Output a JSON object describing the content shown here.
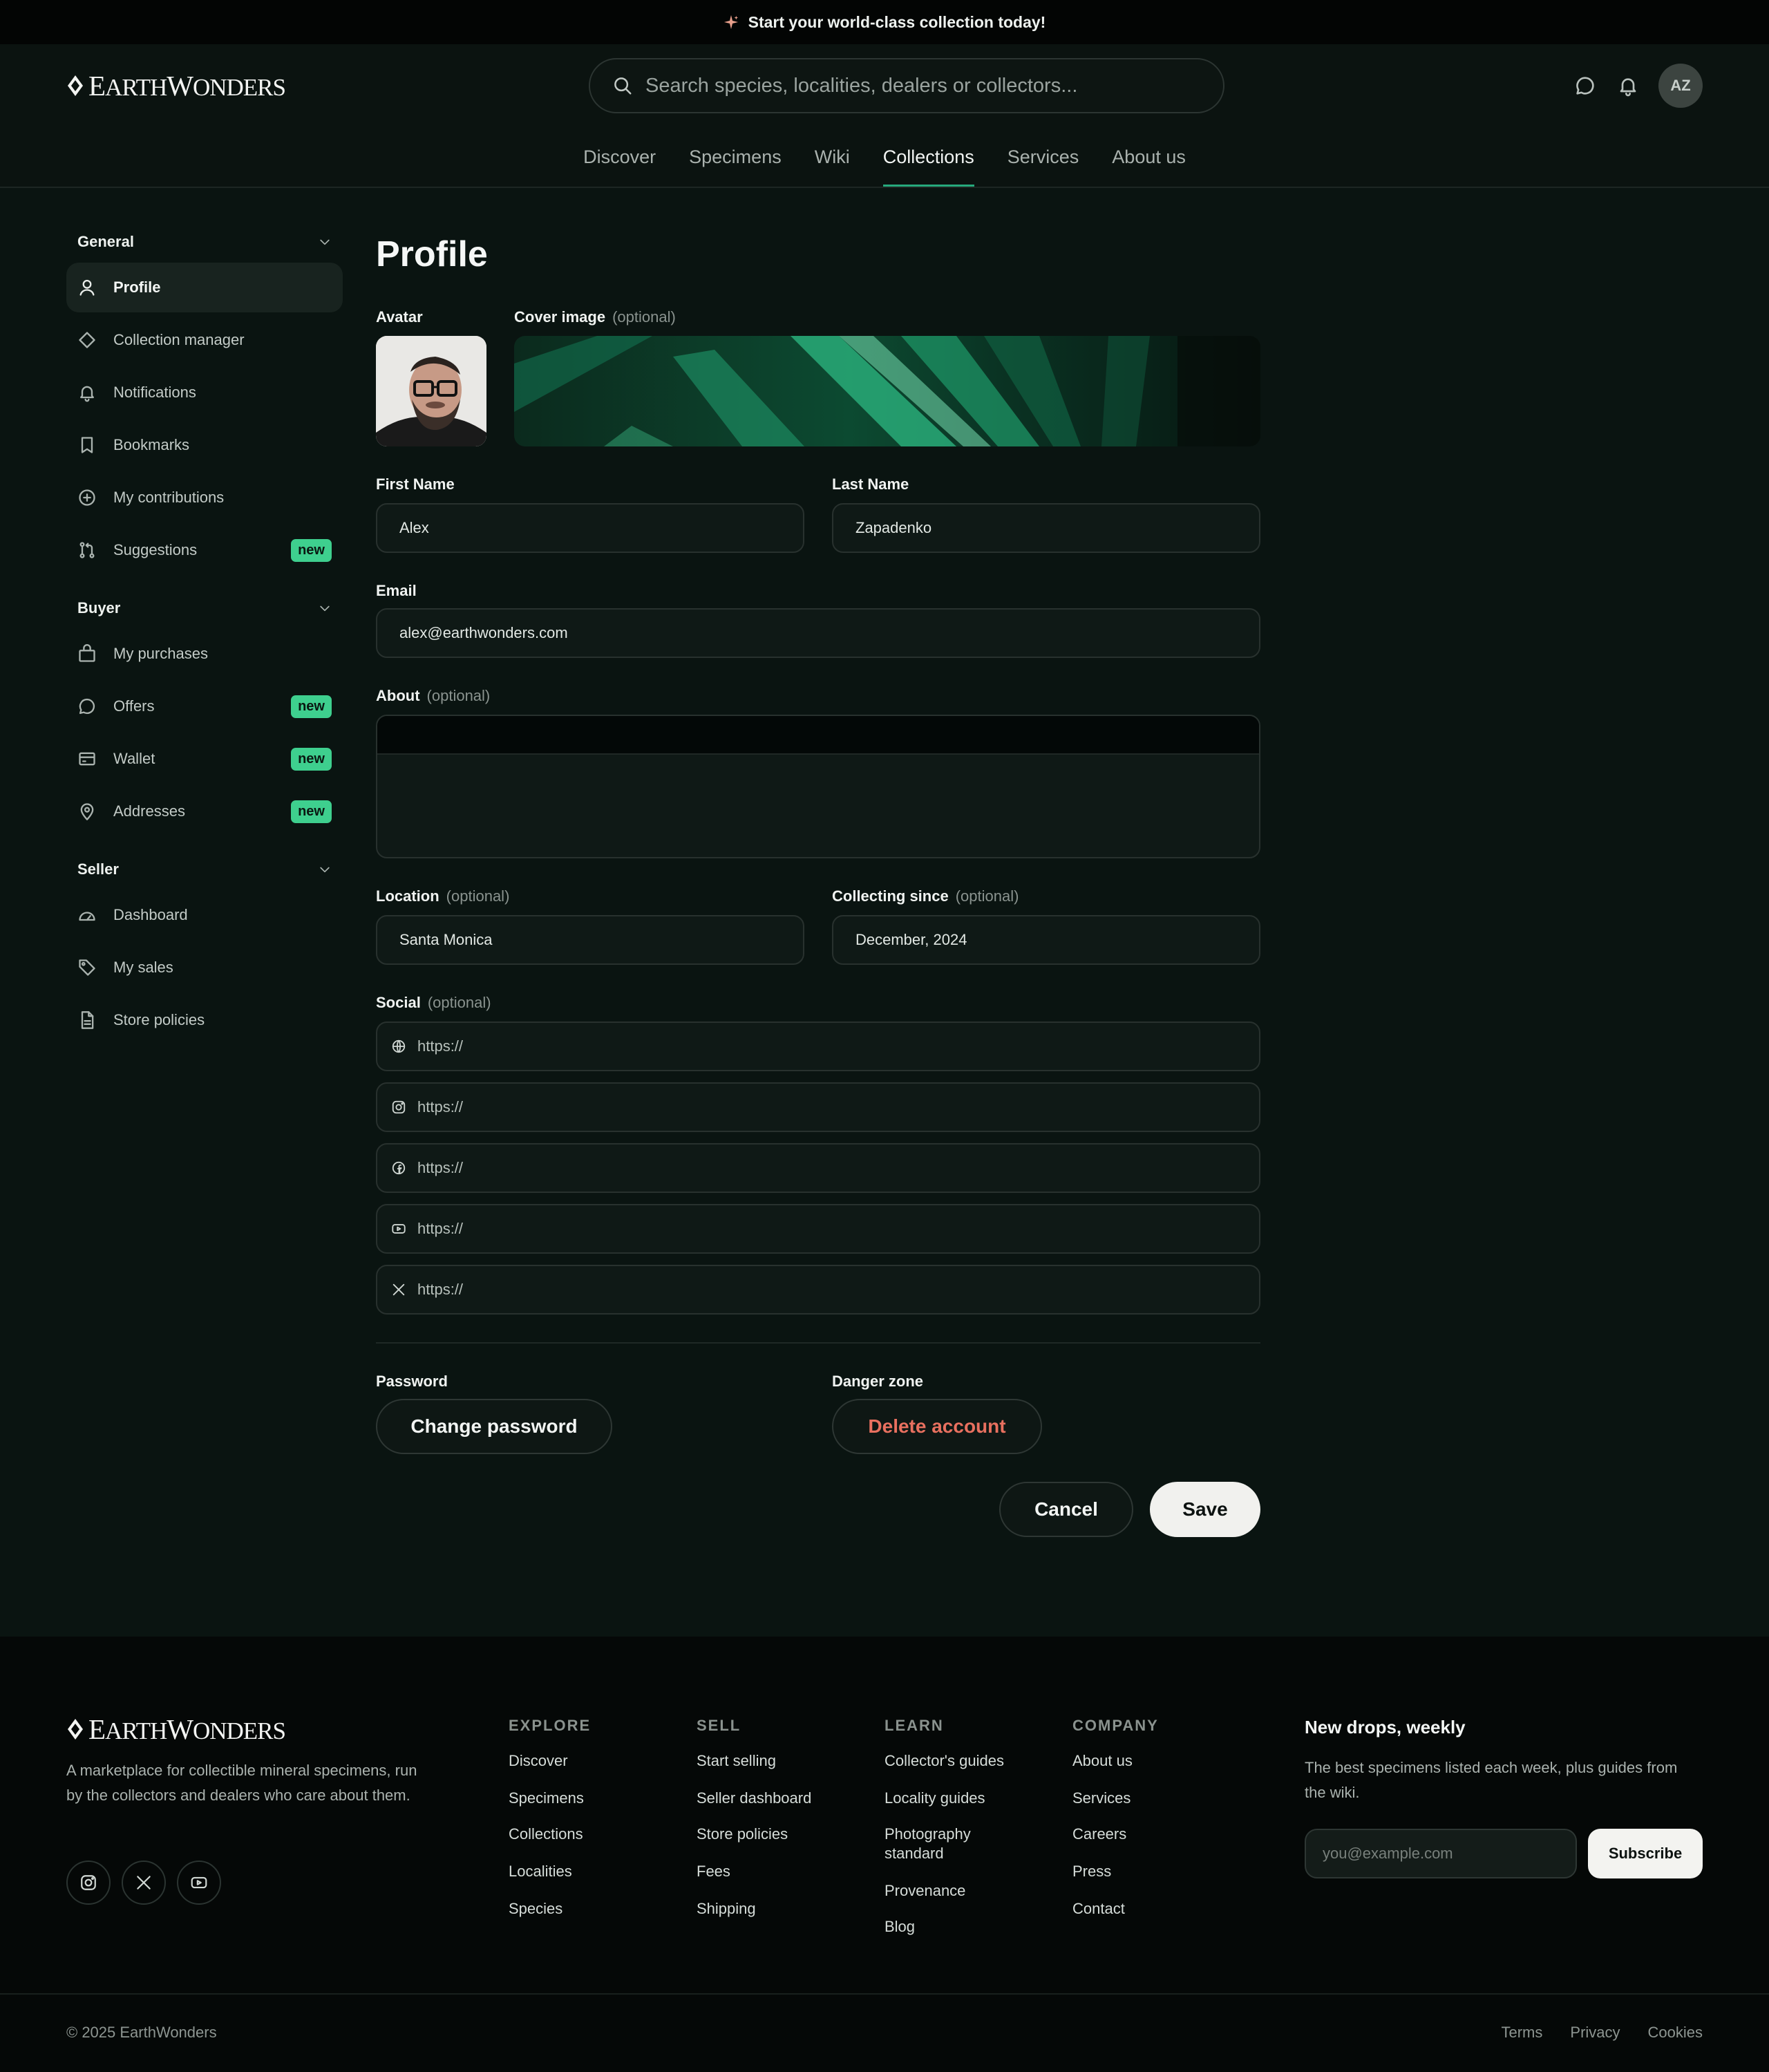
{
  "topbar": {
    "icon": "sparkle-icon",
    "text": "Start your world-class collection today!",
    "accent": "#e8a08c"
  },
  "header": {
    "brand": {
      "first": "E",
      "rest1": "ARTH",
      "second": "W",
      "rest2": "ONDERS"
    },
    "search_placeholder": "Search species, localities, dealers or collectors...",
    "avatar_initials": "AZ",
    "nav": [
      {
        "label": "Discover"
      },
      {
        "label": "Specimens"
      },
      {
        "label": "Wiki"
      },
      {
        "label": "Collections",
        "active": true
      },
      {
        "label": "Services"
      },
      {
        "label": "About us"
      }
    ]
  },
  "sidebar": {
    "sections": [
      {
        "title": "General",
        "items": [
          {
            "label": "Profile",
            "icon": "user-icon",
            "active": true
          },
          {
            "label": "Collection manager",
            "icon": "diamond-icon"
          },
          {
            "label": "Notifications",
            "icon": "bell-icon"
          },
          {
            "label": "Bookmarks",
            "icon": "bookmark-icon"
          },
          {
            "label": "My contributions",
            "icon": "plus-circle-icon"
          },
          {
            "label": "Suggestions",
            "icon": "git-pull-icon",
            "badge": "new"
          }
        ]
      },
      {
        "title": "Buyer",
        "items": [
          {
            "label": "My purchases",
            "icon": "bag-icon"
          },
          {
            "label": "Offers",
            "icon": "chat-icon",
            "badge": "new"
          },
          {
            "label": "Wallet",
            "icon": "card-icon",
            "badge": "new"
          },
          {
            "label": "Addresses",
            "icon": "pin-icon",
            "badge": "new"
          }
        ]
      },
      {
        "title": "Seller",
        "items": [
          {
            "label": "Dashboard",
            "icon": "gauge-icon"
          },
          {
            "label": "My sales",
            "icon": "tag-icon"
          },
          {
            "label": "Store policies",
            "icon": "document-icon"
          }
        ]
      }
    ]
  },
  "profile": {
    "title": "Profile",
    "avatar_label": "Avatar",
    "cover_label": "Cover image",
    "optional": "(optional)",
    "first_name_label": "First Name",
    "first_name": "Alex",
    "last_name_label": "Last Name",
    "last_name": "Zapadenko",
    "email_label": "Email",
    "email": "alex@earthwonders.com",
    "about_label": "About",
    "about": "",
    "location_label": "Location",
    "location": "Santa Monica",
    "since_label": "Collecting since",
    "since": "December, 2024",
    "social_label": "Social",
    "social": [
      {
        "icon": "globe-icon",
        "placeholder": "https://"
      },
      {
        "icon": "instagram-icon",
        "placeholder": "https://"
      },
      {
        "icon": "facebook-icon",
        "placeholder": "https://"
      },
      {
        "icon": "youtube-icon",
        "placeholder": "https://"
      },
      {
        "icon": "x-icon",
        "placeholder": "https://"
      }
    ],
    "password_label": "Password",
    "change_password": "Change password",
    "danger_label": "Danger zone",
    "delete_account": "Delete account",
    "delete_color": "#e8705f",
    "cancel": "Cancel",
    "save": "Save"
  },
  "footer": {
    "tagline": "A marketplace for collectible mineral specimens, run by the collectors and dealers who care about them.",
    "columns": [
      {
        "title": "EXPLORE",
        "links": [
          "Discover",
          "Specimens",
          "Collections",
          "Localities",
          "Species"
        ]
      },
      {
        "title": "SELL",
        "links": [
          "Start selling",
          "Seller dashboard",
          "Store policies",
          "Fees",
          "Shipping"
        ]
      },
      {
        "title": "LEARN",
        "links": [
          "Collector's guides",
          "Locality guides",
          "Photography standard",
          "Provenance",
          "Blog"
        ]
      },
      {
        "title": "COMPANY",
        "links": [
          "About us",
          "Services",
          "Careers",
          "Press",
          "Contact"
        ]
      }
    ],
    "newsletter_title": "New drops, weekly",
    "newsletter_text": "The best specimens listed each week, plus guides from the wiki.",
    "newsletter_placeholder": "you@example.com",
    "subscribe": "Subscribe",
    "copyright": "© 2025 EarthWonders",
    "legal": [
      "Terms",
      "Privacy",
      "Cookies"
    ]
  }
}
